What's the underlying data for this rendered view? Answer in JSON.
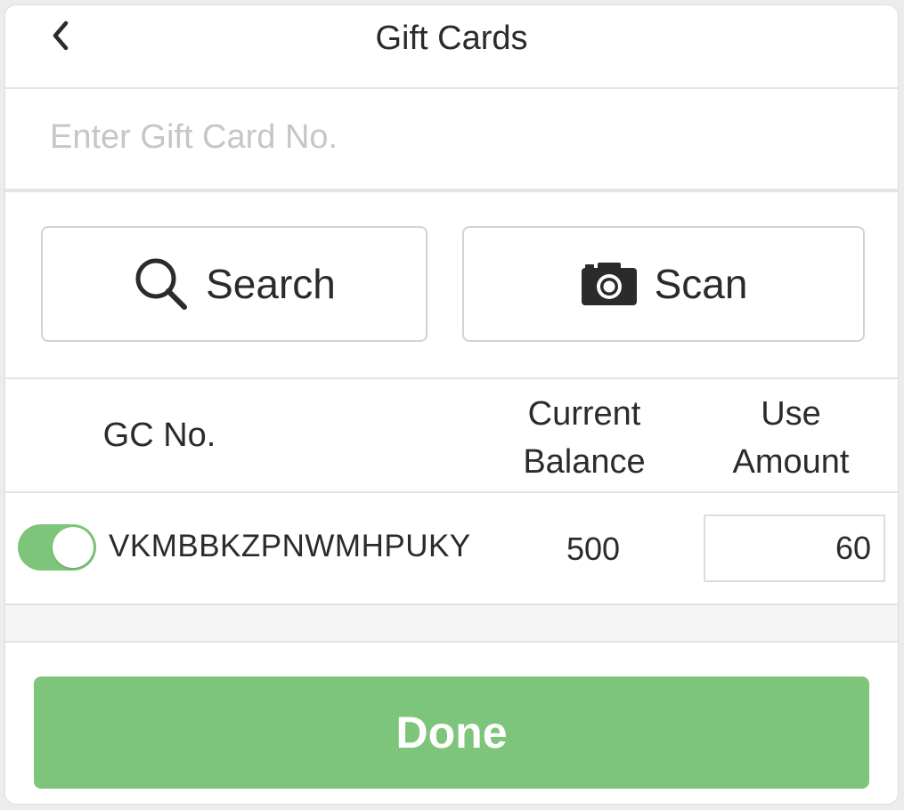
{
  "header": {
    "title": "Gift Cards",
    "back_icon": "chevron-left-icon"
  },
  "gift_card_input": {
    "placeholder": "Enter Gift Card No.",
    "value": ""
  },
  "actions": {
    "search": {
      "label": "Search",
      "icon": "search-icon"
    },
    "scan": {
      "label": "Scan",
      "icon": "camera-icon"
    }
  },
  "table": {
    "columns": {
      "gc_no": "GC No.",
      "current_balance_line1": "Current",
      "current_balance_line2": "Balance",
      "use_amount_line1": "Use",
      "use_amount_line2": "Amount"
    },
    "rows": [
      {
        "enabled": true,
        "gc_no": "VKMBBKZPNWMHPUKY",
        "current_balance": "500",
        "use_amount": "60"
      }
    ]
  },
  "done": {
    "label": "Done"
  },
  "colors": {
    "accent_green": "#7dc57a",
    "text": "#2b2b2b",
    "placeholder": "#c6c6c6",
    "divider": "#e4e4e4"
  }
}
